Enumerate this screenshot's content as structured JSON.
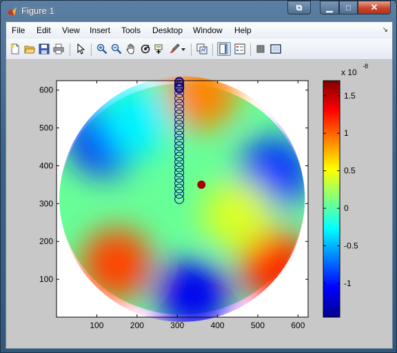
{
  "window": {
    "title": "Figure 1",
    "dock_glyph": "⧉",
    "min_glyph": "▁",
    "max_glyph": "□",
    "close_glyph": "✕"
  },
  "menu": {
    "items": [
      "File",
      "Edit",
      "View",
      "Insert",
      "Tools",
      "Desktop",
      "Window",
      "Help"
    ],
    "arrow": "↘"
  },
  "toolbar": {
    "icons": [
      "new-figure-icon",
      "open-file-icon",
      "save-icon",
      "print-icon",
      "pointer-icon",
      "zoom-in-icon",
      "zoom-out-icon",
      "pan-hand-icon",
      "rotate-3d-icon",
      "data-cursor-icon",
      "brush-icon",
      "brush-dropdown-icon",
      "link-plot-icon",
      "colorbar-icon",
      "legend-icon",
      "hide-plot-tools-icon",
      "show-plot-tools-icon"
    ]
  },
  "chart_data": {
    "type": "heatmap",
    "title": "",
    "xlabel": "",
    "ylabel": "",
    "xlim": [
      0,
      625
    ],
    "ylim": [
      0,
      625
    ],
    "xticks": [
      100,
      200,
      300,
      400,
      500,
      600
    ],
    "yticks": [
      100,
      200,
      300,
      400,
      500,
      600
    ],
    "colormap": "jet",
    "colorbar": {
      "range": [
        -1.45,
        1.7
      ],
      "ticks": [
        -1,
        -0.5,
        0,
        0.5,
        1,
        1.5
      ],
      "tick_labels": [
        "-1",
        "-0.5",
        "0",
        "0.5",
        "1",
        "1.5"
      ],
      "exponent_label": "x 10",
      "exponent": "-8"
    },
    "domain": {
      "shape": "circle",
      "center": [
        312,
        312
      ],
      "radius": 305
    },
    "features": [
      {
        "x": 120,
        "y": 470,
        "value": -1.0
      },
      {
        "x": 150,
        "y": 140,
        "value": 1.1
      },
      {
        "x": 540,
        "y": 140,
        "value": 1.2
      },
      {
        "x": 340,
        "y": 60,
        "value": -1.1
      },
      {
        "x": 540,
        "y": 380,
        "value": -0.9
      },
      {
        "x": 360,
        "y": 590,
        "value": 0.9
      },
      {
        "x": 360,
        "y": 350,
        "value": 1.6
      },
      {
        "x": 450,
        "y": 270,
        "value": 0.4
      },
      {
        "x": 200,
        "y": 520,
        "value": -0.3
      }
    ],
    "marker_series": {
      "marker": "circle",
      "color": "#00008b",
      "x": [
        305,
        305,
        305,
        305,
        305,
        305,
        305,
        305,
        305,
        305,
        305,
        305,
        305,
        305,
        305,
        305,
        305,
        305,
        305,
        305,
        305,
        305,
        305,
        305,
        305,
        305,
        305,
        305,
        305
      ],
      "y": [
        620,
        606,
        592,
        578,
        564,
        550,
        536,
        522,
        508,
        494,
        480,
        466,
        452,
        438,
        424,
        410,
        396,
        382,
        368,
        354,
        340,
        326,
        312,
        622,
        619,
        615,
        611,
        608,
        604
      ]
    }
  }
}
